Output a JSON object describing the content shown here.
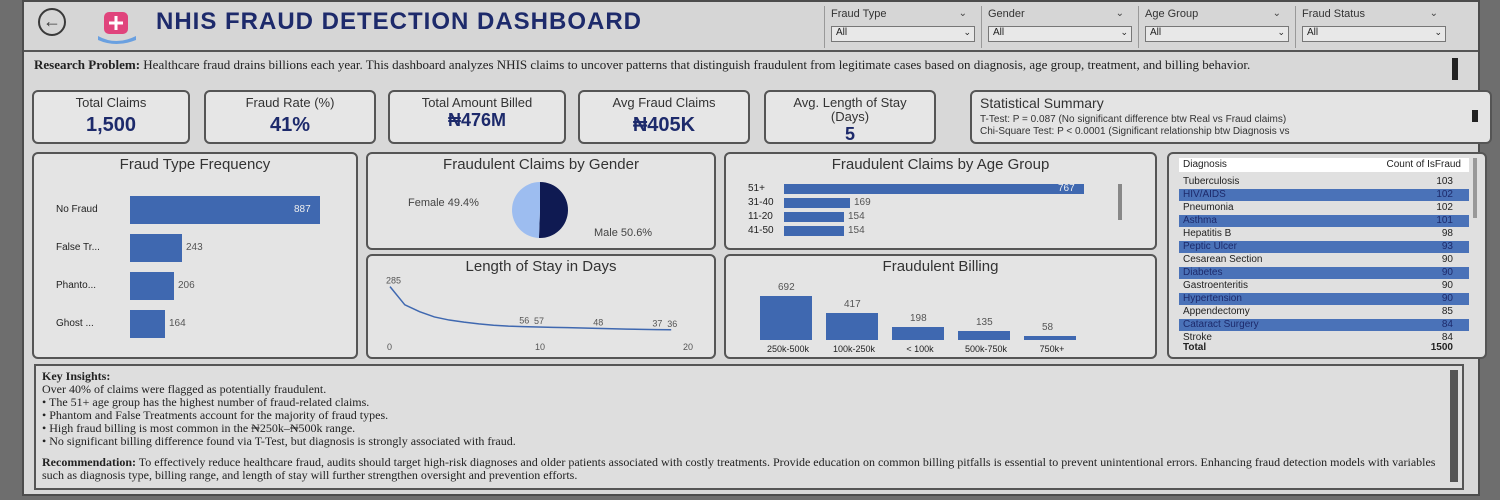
{
  "header": {
    "title": "NHIS FRAUD DETECTION DASHBOARD",
    "back_icon": "arrow-left-icon",
    "logo_icon": "medical-shield-icon"
  },
  "filters": [
    {
      "label": "Fraud Type",
      "value": "All"
    },
    {
      "label": "Gender",
      "value": "All"
    },
    {
      "label": "Age Group",
      "value": "All"
    },
    {
      "label": "Fraud Status",
      "value": "All"
    }
  ],
  "research_problem": {
    "label": "Research Problem:",
    "text": "Healthcare fraud drains billions each year. This dashboard analyzes NHIS claims to uncover patterns that distinguish fraudulent from legitimate cases based on diagnosis, age group, treatment, and billing behavior."
  },
  "kpis": [
    {
      "label": "Total Claims",
      "value": "1,500"
    },
    {
      "label": "Fraud Rate (%)",
      "value": "41%"
    },
    {
      "label": "Total Amount Billed",
      "value": "₦476M"
    },
    {
      "label": "Avg Fraud Claims",
      "value": "₦405K"
    },
    {
      "label": "Avg. Length of Stay (Days)",
      "value": "5"
    }
  ],
  "statistical_summary": {
    "title": "Statistical Summary",
    "line1": "T-Test: P = 0.087 (No significant difference btw Real vs Fraud claims)",
    "line2": "Chi-Square Test: P < 0.0001 (Significant relationship btw Diagnosis vs"
  },
  "fraud_type": {
    "title": "Fraud Type Frequency",
    "chart_data": {
      "type": "bar",
      "orientation": "horizontal",
      "categories": [
        "No Fraud",
        "False Tr...",
        "Phanto...",
        "Ghost ..."
      ],
      "values": [
        887,
        243,
        206,
        164
      ],
      "xlim": [
        0,
        887
      ]
    }
  },
  "gender": {
    "title": "Fraudulent Claims by Gender",
    "chart_data": {
      "type": "pie",
      "labels": [
        "Female",
        "Male"
      ],
      "values": [
        49.4,
        50.6
      ],
      "display": [
        "Female 49.4%",
        "Male 50.6%"
      ],
      "colors": [
        "#9dbdf0",
        "#0f1a52"
      ]
    }
  },
  "age_group": {
    "title": "Fraudulent Claims by Age Group",
    "chart_data": {
      "type": "bar",
      "orientation": "horizontal",
      "categories": [
        "51+",
        "31-40",
        "11-20",
        "41-50"
      ],
      "values": [
        767,
        169,
        154,
        154
      ],
      "xlim": [
        0,
        767
      ]
    }
  },
  "length_of_stay": {
    "title": "Length of Stay in Days",
    "chart_data": {
      "type": "line",
      "x": [
        0,
        1,
        2,
        3,
        4,
        5,
        6,
        7,
        8,
        9,
        10,
        11,
        12,
        13,
        14,
        15,
        16,
        17,
        18,
        19
      ],
      "y": [
        285,
        180,
        140,
        110,
        92,
        80,
        70,
        62,
        57,
        54,
        52,
        50,
        48,
        46,
        44,
        42,
        40,
        38,
        37,
        36
      ],
      "point_labels": [
        {
          "x": 0,
          "label": "285"
        },
        {
          "x": 9,
          "label": "56"
        },
        {
          "x": 10,
          "label": "57"
        },
        {
          "x": 14,
          "label": "48"
        },
        {
          "x": 18,
          "label": "37"
        },
        {
          "x": 19,
          "label": "36"
        }
      ],
      "xticks": [
        "0",
        "10",
        "20"
      ],
      "xlim": [
        0,
        20
      ],
      "ylim": [
        0,
        300
      ]
    }
  },
  "billing": {
    "title": "Fraudulent Billing",
    "chart_data": {
      "type": "bar",
      "categories": [
        "250k-500k",
        "100k-250k",
        "< 100k",
        "500k-750k",
        "750k+"
      ],
      "values": [
        692,
        417,
        198,
        135,
        58
      ],
      "ylim": [
        0,
        692
      ]
    }
  },
  "diagnosis_table": {
    "columns": [
      "Diagnosis",
      "Count of IsFraud"
    ],
    "rows": [
      {
        "name": "Tuberculosis",
        "count": "103"
      },
      {
        "name": "HIV/AIDS",
        "count": "102"
      },
      {
        "name": "Pneumonia",
        "count": "102"
      },
      {
        "name": "Asthma",
        "count": "101"
      },
      {
        "name": "Hepatitis B",
        "count": "98"
      },
      {
        "name": "Peptic Ulcer",
        "count": "93"
      },
      {
        "name": "Cesarean Section",
        "count": "90"
      },
      {
        "name": "Diabetes",
        "count": "90"
      },
      {
        "name": "Gastroenteritis",
        "count": "90"
      },
      {
        "name": "Hypertension",
        "count": "90"
      },
      {
        "name": "Appendectomy",
        "count": "85"
      },
      {
        "name": "Cataract Surgery",
        "count": "84"
      },
      {
        "name": "Stroke",
        "count": "84"
      }
    ],
    "total_label": "Total",
    "total_value": "1500"
  },
  "insights": {
    "heading": "Key Insights:",
    "items": [
      "Over 40% of claims were flagged as potentially fraudulent.",
      "• The 51+ age group has the highest number of fraud-related claims.",
      "• Phantom and False Treatments account for the majority of fraud types.",
      "• High fraud billing is most common in the ₦250k–₦500k range.",
      "• No significant billing difference found via T-Test, but diagnosis is strongly associated with fraud."
    ],
    "recommendation_label": "Recommendation:",
    "recommendation": "To effectively reduce healthcare fraud, audits should target high-risk diagnoses and older patients associated with costly treatments. Provide education on common billing pitfalls is essential to prevent unintentional errors. Enhancing fraud detection models with variables such as diagnosis type, billing range, and length of stay will further strengthen oversight and prevention efforts."
  },
  "colors": {
    "accent": "#3f68b0",
    "title": "#1d2a6b",
    "panel": "#e4e4e4"
  }
}
